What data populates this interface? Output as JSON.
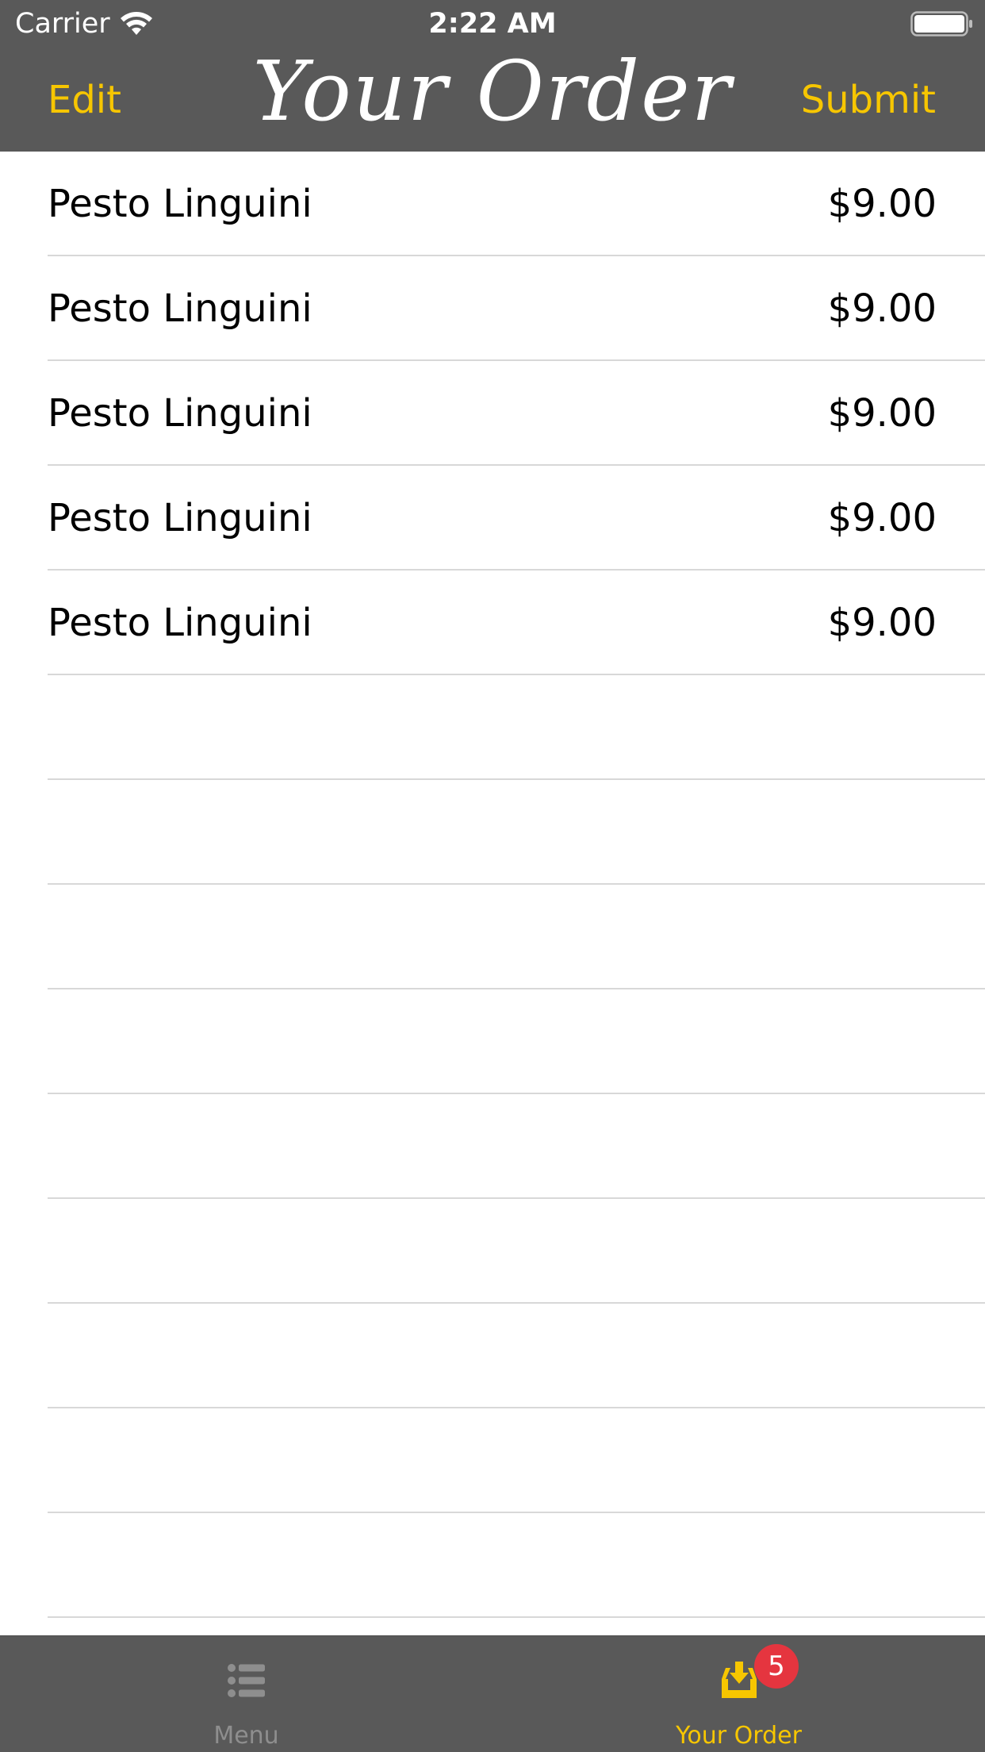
{
  "status_bar": {
    "carrier": "Carrier",
    "time": "2:22 AM"
  },
  "nav": {
    "left_button": "Edit",
    "title": "Your Order",
    "right_button": "Submit"
  },
  "order_items": [
    {
      "name": "Pesto Linguini",
      "price": "$9.00"
    },
    {
      "name": "Pesto Linguini",
      "price": "$9.00"
    },
    {
      "name": "Pesto Linguini",
      "price": "$9.00"
    },
    {
      "name": "Pesto Linguini",
      "price": "$9.00"
    },
    {
      "name": "Pesto Linguini",
      "price": "$9.00"
    }
  ],
  "tab_bar": {
    "tabs": [
      {
        "label": "Menu",
        "icon": "list-icon",
        "selected": false
      },
      {
        "label": "Your Order",
        "icon": "order-tray-icon",
        "selected": true,
        "badge": "5"
      }
    ]
  },
  "colors": {
    "bar_background": "#595959",
    "accent": "#f7c600",
    "badge": "#e5353f",
    "inactive_tab": "#8e8e8e"
  }
}
